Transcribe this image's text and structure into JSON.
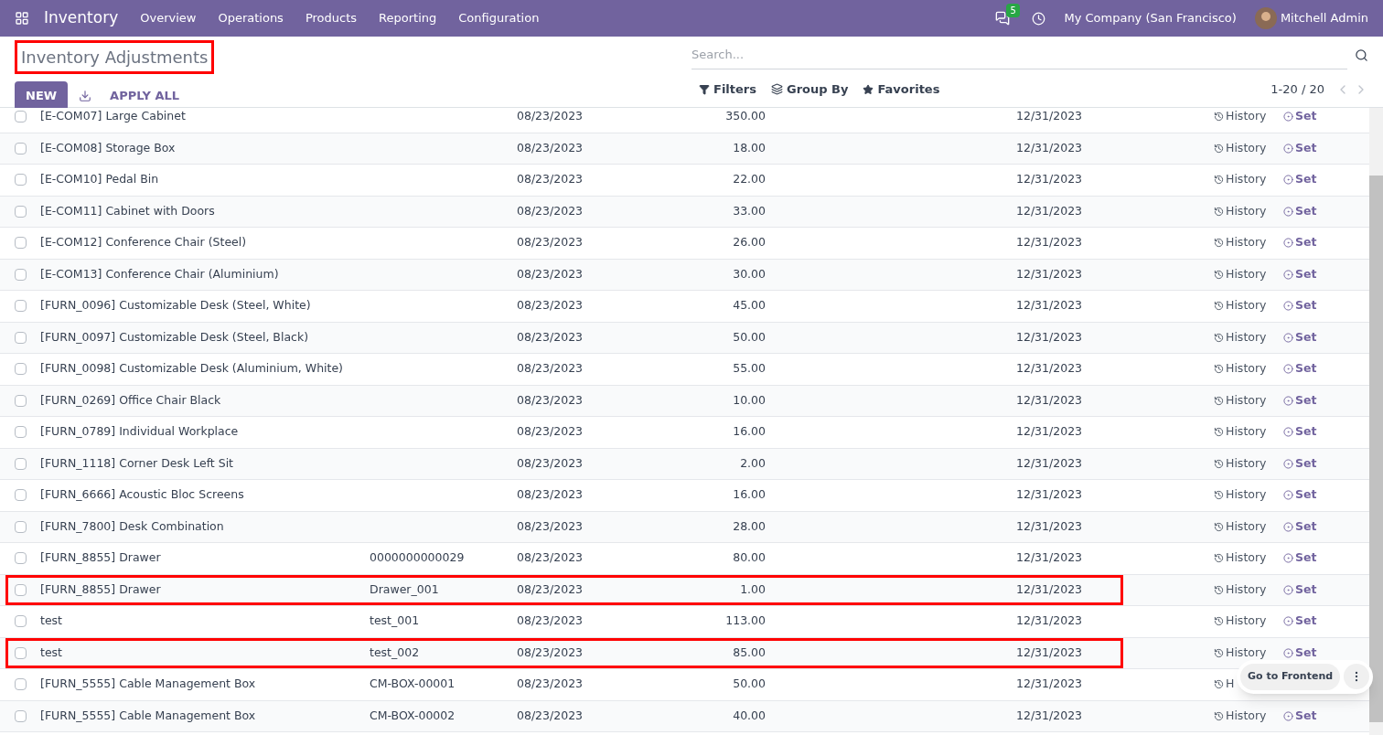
{
  "navbar": {
    "app": "Inventory",
    "menus": [
      "Overview",
      "Operations",
      "Products",
      "Reporting",
      "Configuration"
    ],
    "message_count": "5",
    "company": "My Company (San Francisco)",
    "user": "Mitchell Admin"
  },
  "control_panel": {
    "title": "Inventory Adjustments",
    "title_highlighted": true,
    "new_button": "NEW",
    "apply_all": "APPLY ALL",
    "search": {
      "placeholder": "Search..."
    },
    "filters": "Filters",
    "group_by": "Group By",
    "favorites": "Favorites",
    "pager": "1-20 / 20"
  },
  "rows": [
    {
      "checked": false,
      "product": "[E-COM07] Large Cabinet",
      "lot": "",
      "date": "08/23/2023",
      "quantity": "350.00",
      "scheduled": "12/31/2023",
      "history": "History",
      "set": "Set",
      "highlighted": false
    },
    {
      "checked": false,
      "product": "[E-COM08] Storage Box",
      "lot": "",
      "date": "08/23/2023",
      "quantity": "18.00",
      "scheduled": "12/31/2023",
      "history": "History",
      "set": "Set",
      "highlighted": false
    },
    {
      "checked": false,
      "product": "[E-COM10] Pedal Bin",
      "lot": "",
      "date": "08/23/2023",
      "quantity": "22.00",
      "scheduled": "12/31/2023",
      "history": "History",
      "set": "Set",
      "highlighted": false
    },
    {
      "checked": false,
      "product": "[E-COM11] Cabinet with Doors",
      "lot": "",
      "date": "08/23/2023",
      "quantity": "33.00",
      "scheduled": "12/31/2023",
      "history": "History",
      "set": "Set",
      "highlighted": false
    },
    {
      "checked": false,
      "product": "[E-COM12] Conference Chair (Steel)",
      "lot": "",
      "date": "08/23/2023",
      "quantity": "26.00",
      "scheduled": "12/31/2023",
      "history": "History",
      "set": "Set",
      "highlighted": false
    },
    {
      "checked": false,
      "product": "[E-COM13] Conference Chair (Aluminium)",
      "lot": "",
      "date": "08/23/2023",
      "quantity": "30.00",
      "scheduled": "12/31/2023",
      "history": "History",
      "set": "Set",
      "highlighted": false
    },
    {
      "checked": false,
      "product": "[FURN_0096] Customizable Desk (Steel, White)",
      "lot": "",
      "date": "08/23/2023",
      "quantity": "45.00",
      "scheduled": "12/31/2023",
      "history": "History",
      "set": "Set",
      "highlighted": false
    },
    {
      "checked": false,
      "product": "[FURN_0097] Customizable Desk (Steel, Black)",
      "lot": "",
      "date": "08/23/2023",
      "quantity": "50.00",
      "scheduled": "12/31/2023",
      "history": "History",
      "set": "Set",
      "highlighted": false
    },
    {
      "checked": false,
      "product": "[FURN_0098] Customizable Desk (Aluminium, White)",
      "lot": "",
      "date": "08/23/2023",
      "quantity": "55.00",
      "scheduled": "12/31/2023",
      "history": "History",
      "set": "Set",
      "highlighted": false
    },
    {
      "checked": false,
      "product": "[FURN_0269] Office Chair Black",
      "lot": "",
      "date": "08/23/2023",
      "quantity": "10.00",
      "scheduled": "12/31/2023",
      "history": "History",
      "set": "Set",
      "highlighted": false
    },
    {
      "checked": false,
      "product": "[FURN_0789] Individual Workplace",
      "lot": "",
      "date": "08/23/2023",
      "quantity": "16.00",
      "scheduled": "12/31/2023",
      "history": "History",
      "set": "Set",
      "highlighted": false
    },
    {
      "checked": false,
      "product": "[FURN_1118] Corner Desk Left Sit",
      "lot": "",
      "date": "08/23/2023",
      "quantity": "2.00",
      "scheduled": "12/31/2023",
      "history": "History",
      "set": "Set",
      "highlighted": false
    },
    {
      "checked": false,
      "product": "[FURN_6666] Acoustic Bloc Screens",
      "lot": "",
      "date": "08/23/2023",
      "quantity": "16.00",
      "scheduled": "12/31/2023",
      "history": "History",
      "set": "Set",
      "highlighted": false
    },
    {
      "checked": false,
      "product": "[FURN_7800] Desk Combination",
      "lot": "",
      "date": "08/23/2023",
      "quantity": "28.00",
      "scheduled": "12/31/2023",
      "history": "History",
      "set": "Set",
      "highlighted": false
    },
    {
      "checked": false,
      "product": "[FURN_8855] Drawer",
      "lot": "0000000000029",
      "date": "08/23/2023",
      "quantity": "80.00",
      "scheduled": "12/31/2023",
      "history": "History",
      "set": "Set",
      "highlighted": false
    },
    {
      "checked": false,
      "product": "[FURN_8855] Drawer",
      "lot": "Drawer_001",
      "date": "08/23/2023",
      "quantity": "1.00",
      "scheduled": "12/31/2023",
      "history": "History",
      "set": "Set",
      "highlighted": true
    },
    {
      "checked": false,
      "product": "test",
      "lot": "test_001",
      "date": "08/23/2023",
      "quantity": "113.00",
      "scheduled": "12/31/2023",
      "history": "History",
      "set": "Set",
      "highlighted": false
    },
    {
      "checked": false,
      "product": "test",
      "lot": "test_002",
      "date": "08/23/2023",
      "quantity": "85.00",
      "scheduled": "12/31/2023",
      "history": "History",
      "set": "Set",
      "highlighted": true
    },
    {
      "checked": false,
      "product": "[FURN_5555] Cable Management Box",
      "lot": "CM-BOX-00001",
      "date": "08/23/2023",
      "quantity": "50.00",
      "scheduled": "12/31/2023",
      "history": "H",
      "highlighted": false
    },
    {
      "checked": false,
      "product": "[FURN_5555] Cable Management Box",
      "lot": "CM-BOX-00002",
      "date": "08/23/2023",
      "quantity": "40.00",
      "scheduled": "12/31/2023",
      "history": "History",
      "set": "Set",
      "highlighted": false
    }
  ],
  "frontend_popup": {
    "label": "Go to Frontend"
  }
}
